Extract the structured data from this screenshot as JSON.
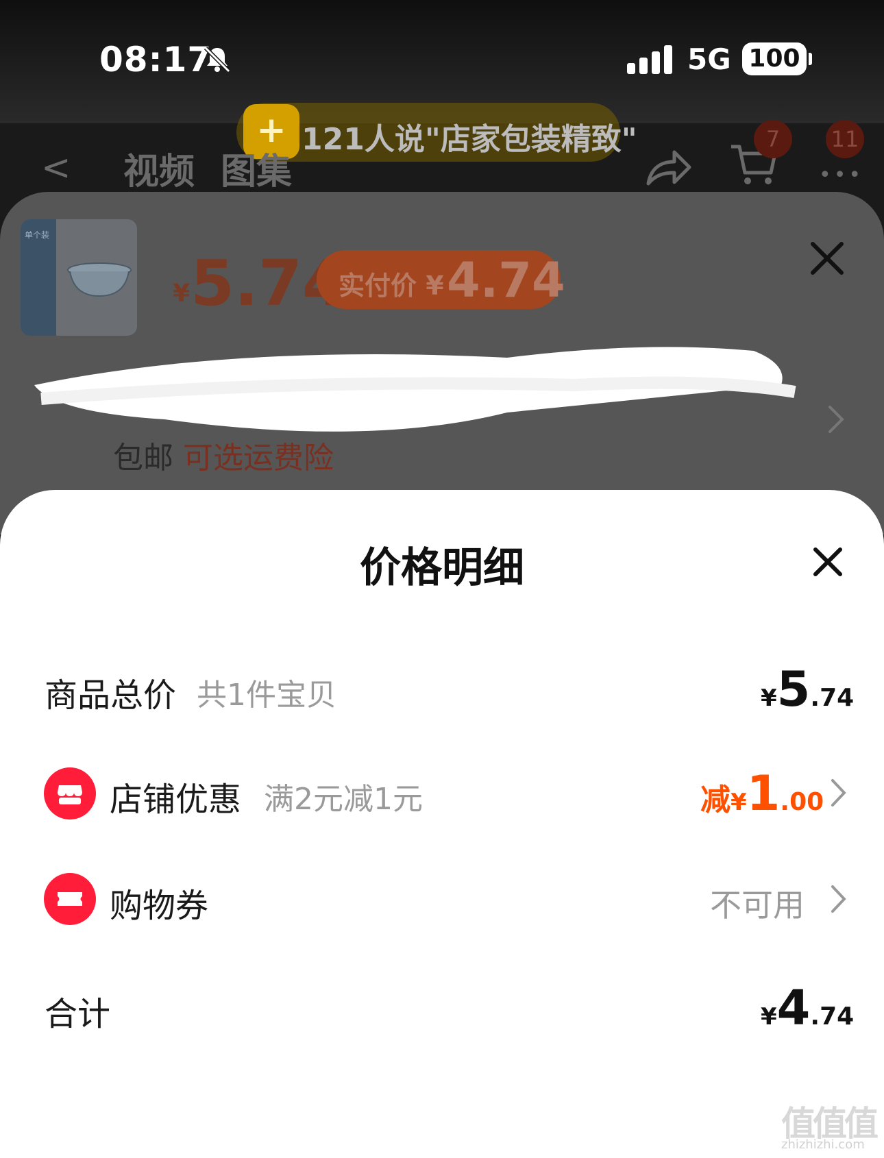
{
  "status_bar": {
    "time": "08:17",
    "network": "5G",
    "battery": "100"
  },
  "promo_banner": {
    "text": "121人说\"店家包装精致\""
  },
  "nav": {
    "back": "<",
    "tabs": [
      "视频",
      "图集"
    ],
    "cart_badge": "7",
    "more_badge": "11"
  },
  "sku": {
    "thumb_tag": "单个装",
    "price_yen": "¥",
    "price": "5.74",
    "pay_label": "实付价 ¥",
    "pay_price": "4.74",
    "shipping_free": "包邮",
    "shipping_insurance": "可选运费险"
  },
  "detail": {
    "title": "价格明细",
    "rows": {
      "total": {
        "label": "商品总价",
        "sub": "共1件宝贝",
        "yen": "¥",
        "int": "5",
        "dec": ".74"
      },
      "shop_discount": {
        "label": "店铺优惠",
        "sub": "满2元减1元",
        "prefix": "减",
        "yen": "¥",
        "int": "1",
        "dec": ".00"
      },
      "coupon": {
        "label": "购物券",
        "value": "不可用"
      },
      "sum": {
        "label": "合计",
        "yen": "¥",
        "int": "4",
        "dec": ".74"
      }
    }
  },
  "watermark": {
    "text": "值值值",
    "sub": "zhizhizhi.com"
  },
  "colors": {
    "accent": "#ff5000",
    "icon_red": "#ff1d3a",
    "sheet_grey": "#565656"
  }
}
